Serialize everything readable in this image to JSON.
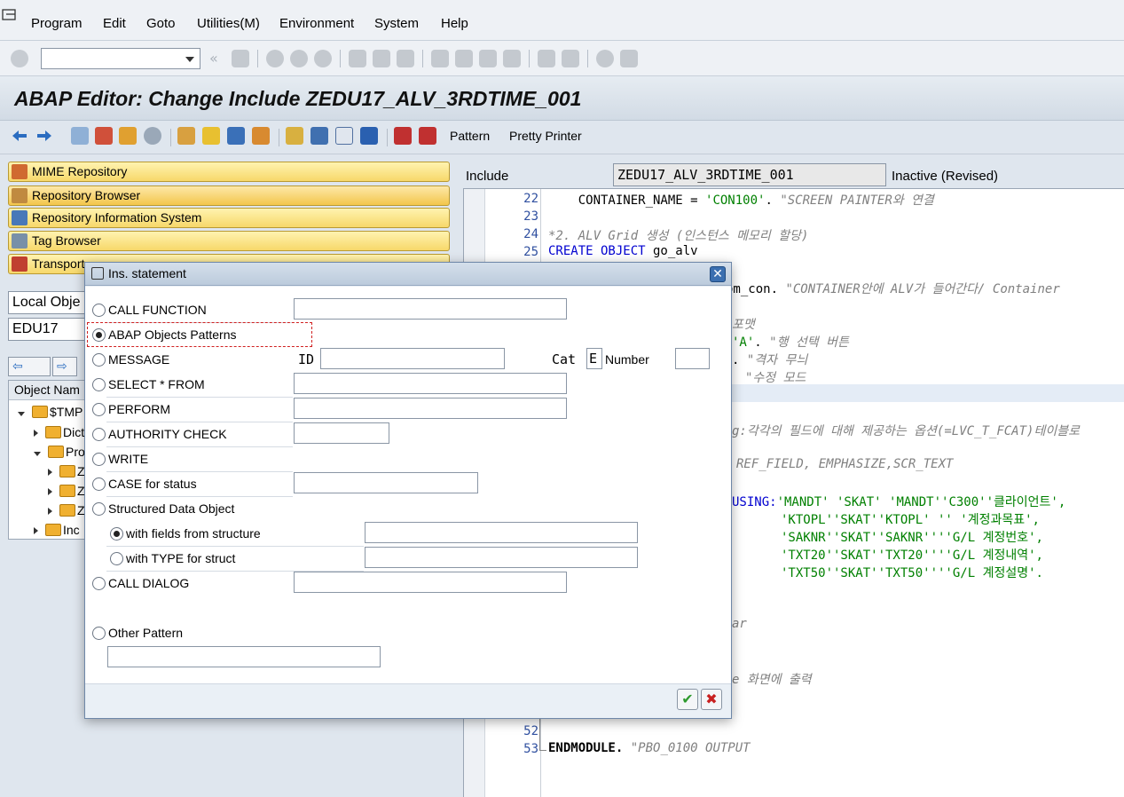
{
  "menu": [
    "Program",
    "Edit",
    "Goto",
    "Utilities(M)",
    "Environment",
    "System",
    "Help"
  ],
  "title": "ABAP Editor: Change Include ZEDU17_ALV_3RDTIME_001",
  "appbar": {
    "pattern": "Pattern",
    "pretty_printer": "Pretty Printer"
  },
  "nav": {
    "buttons": [
      "MIME Repository",
      "Repository Browser",
      "Repository Information System",
      "Tag Browser",
      "Transport"
    ],
    "object_list_type": "Local Obje",
    "object_user": "EDU17",
    "tree_header": "Object Nam",
    "tree": [
      "$TMP",
      "Dict",
      "Pro",
      "Z",
      "Z",
      "Z",
      "Inc"
    ]
  },
  "editor": {
    "include_label": "Include",
    "include_name": "ZEDU17_ALV_3RDTIME_001",
    "status": "Inactive (Revised)",
    "line_numbers": [
      "22",
      "23",
      "24",
      "25",
      "52",
      "53"
    ],
    "lines": {
      "l22a": "    CONTAINER_NAME = ",
      "l22b": "'CON100'",
      "l22c": ". ",
      "l22d": "\"SCREEN PAINTER와 연결",
      "l24": "*2. ALV Grid 생성 (인스턴스 메모리 할당)",
      "l25a": "CREATE OBJECT",
      "l25b": " go_alv",
      "l26a": "om_con. ",
      "l26b": "\"CONTAINER안에 ALV가 들어간다/ Container",
      "l28": "포맷",
      "l29a": "'A'",
      "l29b": ". ",
      "l29c": "\"행 선택 버튼",
      "l30a": ". ",
      "l30b": "\"격자 무늬",
      "l31": "\"수정 모드",
      "l33a": "g:",
      "l33b": "각각의 필드에 대해 제공하는 옵션(=LVC_T_FCAT)테이블로",
      "l35": "REF_FIELD, EMPHASIZE,SCR_TEXT",
      "l37a": "USING:",
      "l37b": "'MANDT' 'SKAT' 'MANDT''C300''클라이언트',",
      "l38": "'KTOPL''SKAT''KTOPL' '' '계정과목표',",
      "l39": "'SAKNR''SKAT''SAKNR''''G/L 계정번호',",
      "l40": "'TXT20''SKAT''TXT20''''G/L 계정내역',",
      "l41": "'TXT50''SKAT''TXT50''''G/L 계정설명'.",
      "l44": "ar",
      "l47": "e 화면에 출력",
      "l53a": "ENDMODULE.",
      "l53b": " \"PBO_0100 OUTPUT"
    }
  },
  "dialog": {
    "title": "Ins. statement",
    "options": {
      "call_function": "CALL FUNCTION",
      "abap_objects": "ABAP Objects Patterns",
      "message": "MESSAGE",
      "select": "SELECT * FROM",
      "perform": "PERFORM",
      "authority": "AUTHORITY CHECK",
      "write": "WRITE",
      "case": "CASE for status",
      "structured": "Structured Data Object",
      "with_fields": "with fields from structure",
      "with_type": "with TYPE for struct",
      "call_dialog": "CALL DIALOG",
      "other": "Other Pattern"
    },
    "message_id_label": "ID",
    "cat_label": "Cat",
    "cat_value": "E",
    "number_label": "Number",
    "ok_icon": "check-icon",
    "cancel_icon": "cancel-icon"
  }
}
